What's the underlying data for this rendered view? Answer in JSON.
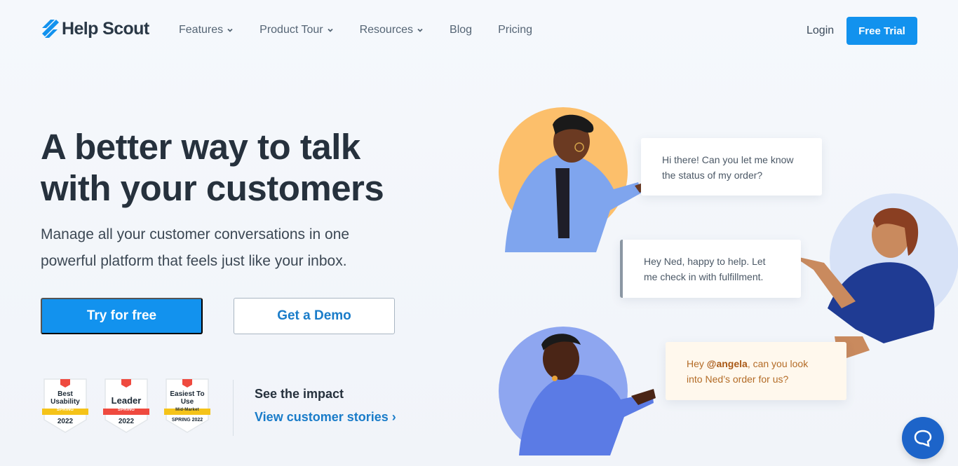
{
  "header": {
    "logo_text": "Help Scout",
    "nav": [
      {
        "label": "Features",
        "has_dropdown": true
      },
      {
        "label": "Product Tour",
        "has_dropdown": true
      },
      {
        "label": "Resources",
        "has_dropdown": true
      },
      {
        "label": "Blog",
        "has_dropdown": false
      },
      {
        "label": "Pricing",
        "has_dropdown": false
      }
    ],
    "login": "Login",
    "free_trial": "Free Trial"
  },
  "hero": {
    "title": "A better way to talk\nwith your customers",
    "subtitle": "Manage all your customer conversations in one powerful platform that feels just like your inbox.",
    "primary_cta": "Try for free",
    "secondary_cta": "Get a Demo"
  },
  "badges": [
    {
      "title": "Best Usability",
      "ribbon": "SPRING",
      "year": "2022",
      "ribbon_color": "#f5c319"
    },
    {
      "title": "Leader",
      "ribbon": "SPRING",
      "year": "2022",
      "ribbon_color": "#ef4a3f"
    },
    {
      "title": "Easiest To Use",
      "ribbon": "Mid-Market",
      "year": "SPRING 2022",
      "ribbon_color": "#f5c319"
    }
  ],
  "impact": {
    "title": "See the impact",
    "link": "View customer stories ›"
  },
  "chat": {
    "bubble1": "Hi there! Can you let me know the status of my order?",
    "bubble2": "Hey Ned, happy to help. Let me check in with fulfillment.",
    "bubble3_prefix": "Hey ",
    "bubble3_mention": "@angela",
    "bubble3_suffix": ", can you look into Ned’s order for us?"
  },
  "colors": {
    "accent": "#1292ee",
    "link": "#1a7cc9",
    "fab": "#1d64c9"
  }
}
